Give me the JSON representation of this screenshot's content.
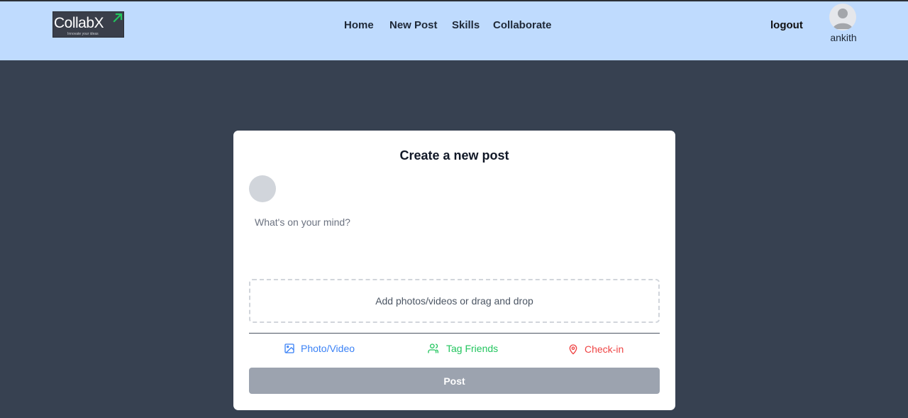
{
  "brand": {
    "name": "CollabX",
    "tagline": "Innovate your ideas",
    "accent_color": "#22c55e"
  },
  "nav": {
    "links": [
      "Home",
      "New Post",
      "Skills",
      "Collaborate"
    ],
    "logout_label": "logout",
    "username": "ankith",
    "avatar_icon": "user-avatar-icon"
  },
  "composer": {
    "title": "Create a new post",
    "placeholder": "What's on your mind?",
    "dropzone_label": "Add photos/videos or drag and drop",
    "actions": [
      {
        "label": "Photo/Video",
        "icon": "image-icon",
        "color": "#3b82f6"
      },
      {
        "label": "Tag Friends",
        "icon": "users-icon",
        "color": "#22c55e"
      },
      {
        "label": "Check-in",
        "icon": "map-pin-icon",
        "color": "#ef4444"
      }
    ],
    "submit_label": "Post"
  },
  "colors": {
    "navbar_bg": "#bfdbfe",
    "page_bg": "#374151",
    "button_disabled": "#9ca3af"
  }
}
